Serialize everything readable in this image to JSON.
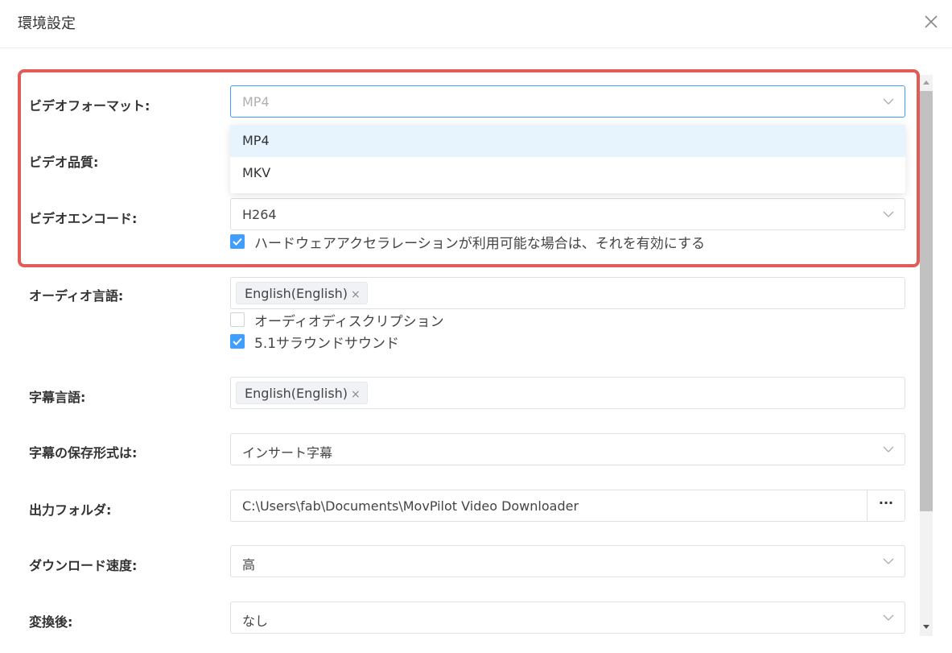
{
  "dialog": {
    "title": "環境設定"
  },
  "settings": {
    "video_format": {
      "label": "ビデオフォーマット:",
      "value": "MP4",
      "options": [
        "MP4",
        "MKV"
      ],
      "selected_option": "MP4"
    },
    "video_quality": {
      "label": "ビデオ品質:"
    },
    "video_encode": {
      "label": "ビデオエンコード:",
      "value": "H264",
      "hw_accel_label": "ハードウェアアクセラレーションが利用可能な場合は、それを有効にする",
      "hw_accel_checked": true
    },
    "audio_language": {
      "label": "オーディオ言語:",
      "tag": "English(English)",
      "audio_description_label": "オーディオディスクリプション",
      "audio_description_checked": false,
      "surround_label": "5.1サラウンドサウンド",
      "surround_checked": true
    },
    "subtitle_language": {
      "label": "字幕言語:",
      "tag": "English(English)"
    },
    "subtitle_format": {
      "label": "字幕の保存形式は:",
      "value": "インサート字幕"
    },
    "output_folder": {
      "label": "出力フォルダ:",
      "value": "C:\\Users\\fab\\Documents\\MovPilot Video Downloader",
      "browse_label": "···"
    },
    "download_speed": {
      "label": "ダウンロード速度:",
      "value": "高"
    },
    "after_conversion": {
      "label": "変換後:",
      "value": "なし"
    }
  },
  "colors": {
    "accent": "#409eff",
    "highlight_border": "#e05c58",
    "selected_option_bg": "#e8f4fd"
  },
  "icons": {
    "close": "close-icon",
    "dropdown": "chevron-down-icon",
    "check": "check-icon",
    "tag_remove": "close-small-icon"
  }
}
